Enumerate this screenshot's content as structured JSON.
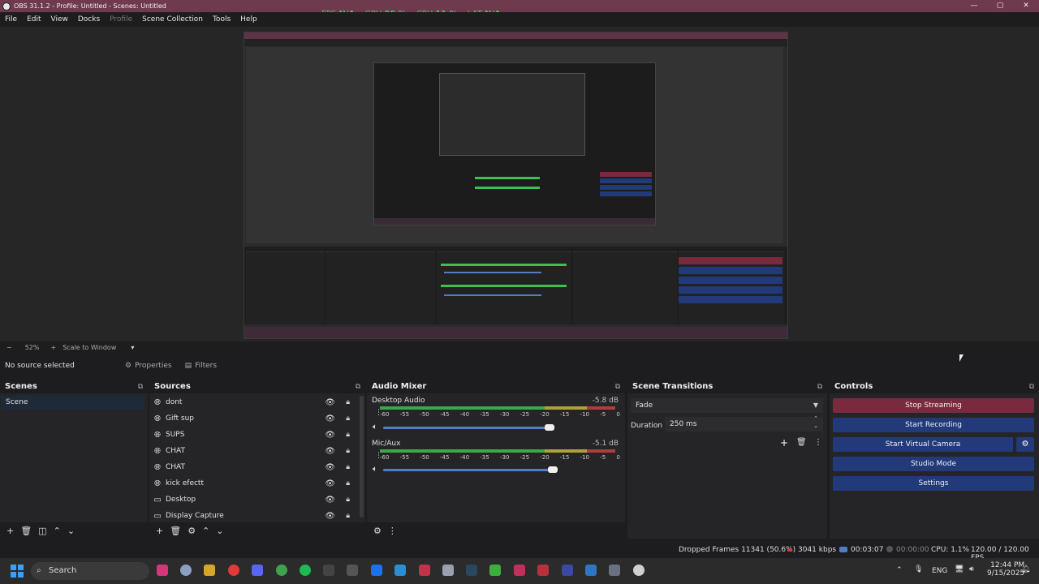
{
  "window": {
    "title": "OBS 31.1.2 - Profile: Untitled - Scenes: Untitled",
    "controls": [
      "—",
      "▢",
      "✕"
    ]
  },
  "stats": {
    "fps_label": "FPS",
    "fps_value": "N/A",
    "gpu_label": "GPU",
    "gpu_value": "25 %",
    "cpu_label": "CPU",
    "cpu_value": "11 %",
    "lat_label": "LAT",
    "lat_value": "N/A"
  },
  "menu": [
    "File",
    "Edit",
    "View",
    "Docks",
    "Profile",
    "Scene Collection",
    "Tools",
    "Help"
  ],
  "zoom": {
    "minus": "−",
    "value": "52%",
    "plus": "+",
    "mode": "Scale to Window",
    "caret": "▾"
  },
  "source_bar": {
    "status": "No source selected",
    "properties": "Properties",
    "filters": "Filters"
  },
  "scenes": {
    "title": "Scenes",
    "items": [
      "Scene"
    ]
  },
  "sources": {
    "title": "Sources",
    "items": [
      {
        "name": "dont",
        "icon": "browser-icon"
      },
      {
        "name": "Gift sup",
        "icon": "browser-icon"
      },
      {
        "name": "SUPS",
        "icon": "browser-icon"
      },
      {
        "name": "CHAT",
        "icon": "browser-icon"
      },
      {
        "name": "CHAT",
        "icon": "browser-icon"
      },
      {
        "name": "kick efectt",
        "icon": "browser-icon"
      },
      {
        "name": "Desktop",
        "icon": "monitor-icon"
      },
      {
        "name": "Display Capture",
        "icon": "monitor-icon"
      }
    ]
  },
  "audio": {
    "title": "Audio Mixer",
    "channels": [
      {
        "name": "Desktop Audio",
        "db": "-5.8 dB",
        "level": 0.93
      },
      {
        "name": "Mic/Aux",
        "db": "-5.1 dB",
        "level": 0.95
      }
    ],
    "ticks": [
      "-60",
      "-55",
      "-50",
      "-45",
      "-40",
      "-35",
      "-30",
      "-25",
      "-20",
      "-15",
      "-10",
      "-5",
      "0"
    ]
  },
  "transitions": {
    "title": "Scene Transitions",
    "selected": "Fade",
    "duration_label": "Duration",
    "duration_value": "250 ms"
  },
  "controls": {
    "title": "Controls",
    "buttons": [
      "Stop Streaming",
      "Start Recording",
      "Start Virtual Camera",
      "Studio Mode",
      "Settings"
    ]
  },
  "status": {
    "dropped": "Dropped Frames 11341 (50.6%)",
    "bitrate": "3041 kbps",
    "stream_time": "00:03:07",
    "rec_time": "00:00:00",
    "cpu": "CPU: 1.1%",
    "fps": "120.00 / 120.00 FPS"
  },
  "taskbar": {
    "search": "Search",
    "lang": "ENG",
    "time": "12:44 PM",
    "date": "9/15/2025"
  },
  "colors": {
    "stop_streaming": "#7a2a3e",
    "control_button": "#223a7a",
    "title_bar": "#6f3a4e",
    "meter_green": "#3fbf4f",
    "meter_yellow": "#c9b63c",
    "meter_red": "#c94040"
  }
}
